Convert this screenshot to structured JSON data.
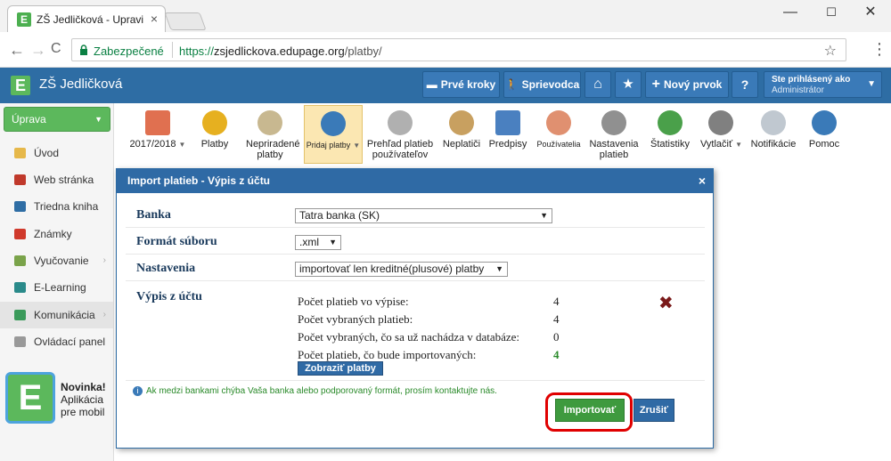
{
  "browser": {
    "tab_title": "ZŠ Jedličková - Upraviť vz",
    "tab_close": "×",
    "window_min": "—",
    "window_max": "☐",
    "window_close": "✕",
    "back": "←",
    "forward": "→",
    "reload": "C",
    "secure_label": "Zabezpečené",
    "url_prefix": "https://",
    "url_domain": "zsjedlickova.edupage.org",
    "url_path": "/platby/",
    "bookmark_star": "☆",
    "menu_dots": "⋮"
  },
  "header": {
    "logo_letter": "E",
    "school_name": "ZŠ Jedličková",
    "buttons": [
      {
        "label": "Prvé kroky",
        "icon": "▬"
      },
      {
        "label": "Sprievodca",
        "icon": "🚶"
      },
      {
        "label": "",
        "icon": "⌂"
      },
      {
        "label": "",
        "icon": "★"
      },
      {
        "label": "Nový prvok",
        "icon": "+"
      },
      {
        "label": "?",
        "icon": ""
      }
    ],
    "user_line1": "Ste prihlásený ako",
    "user_line2": "Administrátor",
    "user_caret": "▼"
  },
  "sidebar": {
    "uprava_label": "Úprava",
    "uprava_caret": "▼",
    "items": [
      {
        "label": "Úvod",
        "color": "#e6b84a"
      },
      {
        "label": "Web stránka",
        "color": "#c0392b"
      },
      {
        "label": "Triedna kniha",
        "color": "#2e6da4"
      },
      {
        "label": "Známky",
        "color": "#d0392b"
      },
      {
        "label": "Vyučovanie",
        "color": "#7aa34a",
        "arrow": "›"
      },
      {
        "label": "E-Learning",
        "color": "#2a8a8a"
      },
      {
        "label": "Komunikácia",
        "color": "#3a9a5a",
        "arrow": "›"
      },
      {
        "label": "Ovládací panel",
        "color": "#999999"
      }
    ],
    "promo_letter": "E",
    "promo_line1": "Novinka!",
    "promo_line2": "Aplikácia",
    "promo_line3": "pre mobil"
  },
  "toolbar": {
    "items": [
      {
        "label1": "2017/2018",
        "label2": "",
        "icon": "calendar-icon",
        "color": "#e07050",
        "caret": "▼"
      },
      {
        "label1": "Platby",
        "label2": "",
        "icon": "coins-icon",
        "color": "#e6b020"
      },
      {
        "label1": "Nepriradené",
        "label2": "platby",
        "icon": "question-coins-icon",
        "color": "#c8b890"
      },
      {
        "label1": "Pridaj platby",
        "label2": "",
        "icon": "add-payment-icon",
        "color": "#3a7ab8",
        "caret": "▼"
      },
      {
        "label1": "Prehľad platieb",
        "label2": "používateľov",
        "icon": "payment-overview-icon",
        "color": "#b0b0b0"
      },
      {
        "label1": "Neplatiči",
        "label2": "",
        "icon": "money-bag-icon",
        "color": "#c8a060"
      },
      {
        "label1": "Predpisy",
        "label2": "",
        "icon": "prescription-icon",
        "color": "#4a80c0"
      },
      {
        "label1": "Používatelia",
        "label2": "",
        "icon": "users-icon",
        "color": "#e09070"
      },
      {
        "label1": "Nastavenia",
        "label2": "platieb",
        "icon": "settings-gear-icon",
        "color": "#909090"
      },
      {
        "label1": "Štatistiky",
        "label2": "",
        "icon": "pie-chart-icon",
        "color": "#4aa04a"
      },
      {
        "label1": "Vytlačiť",
        "label2": "",
        "icon": "printer-icon",
        "color": "#808080",
        "caret": "▼"
      },
      {
        "label1": "Notifikácie",
        "label2": "",
        "icon": "phone-notification-icon",
        "color": "#c0c8d0"
      },
      {
        "label1": "Pomoc",
        "label2": "",
        "icon": "help-icon",
        "color": "#3a7ab8"
      }
    ]
  },
  "dialog": {
    "title": "Import platieb - Výpis z účtu",
    "close": "×",
    "banka_label": "Banka",
    "banka_value": "Tatra banka (SK)",
    "format_label": "Formát súboru",
    "format_value": ".xml",
    "nastavenia_label": "Nastavenia",
    "nastavenia_value": "importovať len kreditné(plusové) platby",
    "vypis_label": "Výpis z účtu",
    "stats": [
      {
        "label": "Počet platieb vo výpise:",
        "value": "4"
      },
      {
        "label": "Počet vybraných platieb:",
        "value": "4"
      },
      {
        "label": "Počet vybraných, čo sa už nachádza v databáze:",
        "value": "0"
      },
      {
        "label": "Počet platieb, čo bude importovaných:",
        "value": "4"
      }
    ],
    "remove_icon": "✖",
    "show_payments_label": "Zobraziť platby",
    "info_icon": "i",
    "info_text": "Ak medzi bankami chýba Vaša banka alebo podporovaný formát, prosím kontaktujte nás.",
    "import_label": "Importovať",
    "cancel_label": "Zrušiť",
    "dropdown_caret": "▼"
  }
}
